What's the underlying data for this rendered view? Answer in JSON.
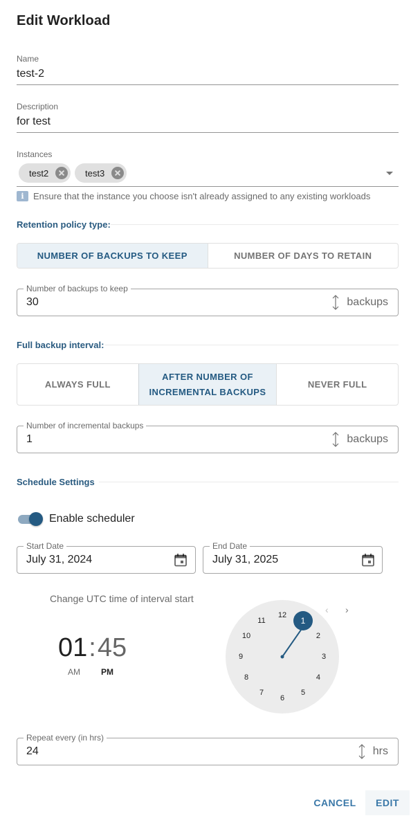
{
  "dialog": {
    "title": "Edit Workload"
  },
  "name": {
    "label": "Name",
    "value": "test-2"
  },
  "description": {
    "label": "Description",
    "value": "for test"
  },
  "instances": {
    "label": "Instances",
    "chips": [
      "test2",
      "test3"
    ],
    "helper_icon": "info-icon",
    "helper_text": "Ensure that the instance you choose isn't already assigned to any existing workloads"
  },
  "retention": {
    "title": "Retention policy type:",
    "options": [
      "NUMBER OF BACKUPS TO KEEP",
      "NUMBER OF DAYS TO RETAIN"
    ],
    "selected": "NUMBER OF BACKUPS TO KEEP",
    "field": {
      "label": "Number of backups to keep",
      "value": "30",
      "unit": "backups"
    }
  },
  "full_backup": {
    "title": "Full backup interval:",
    "options": [
      "ALWAYS FULL",
      "AFTER NUMBER OF INCREMENTAL BACKUPS",
      "NEVER FULL"
    ],
    "selected": "AFTER NUMBER OF INCREMENTAL BACKUPS",
    "field": {
      "label": "Number of incremental backups",
      "value": "1",
      "unit": "backups"
    }
  },
  "schedule": {
    "title": "Schedule Settings",
    "enable_label": "Enable scheduler",
    "enabled": true,
    "start_date": {
      "label": "Start Date",
      "value": "July 31, 2024"
    },
    "end_date": {
      "label": "End Date",
      "value": "July 31, 2025"
    },
    "time_picker": {
      "label": "Change UTC time of interval start",
      "hours": "01",
      "separator": ":",
      "minutes": "45",
      "am": "AM",
      "pm": "PM",
      "selected_period": "PM",
      "clock_numbers": [
        "12",
        "1",
        "2",
        "3",
        "4",
        "5",
        "6",
        "7",
        "8",
        "9",
        "10",
        "11"
      ],
      "selected_hour": "1",
      "prev_icon": "chevron-left-icon",
      "next_icon": "chevron-right-icon"
    },
    "repeat": {
      "label": "Repeat every (in hrs)",
      "value": "24",
      "unit": "hrs"
    }
  },
  "actions": {
    "cancel": "CANCEL",
    "edit": "EDIT"
  },
  "colors": {
    "primary": "#245a82",
    "selected_toggle_bg": "#eaf1f6",
    "section_title": "#2a5b80"
  }
}
